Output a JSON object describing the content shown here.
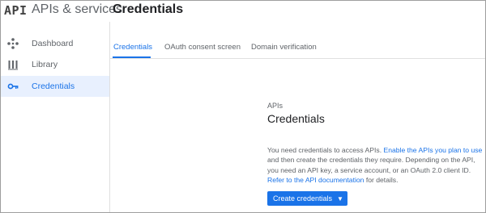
{
  "header": {
    "logo_text": "API",
    "product_name": "APIs & services",
    "page_title": "Credentials"
  },
  "sidebar": {
    "items": [
      {
        "label": "Dashboard",
        "icon": "dashboard-icon",
        "active": false
      },
      {
        "label": "Library",
        "icon": "library-icon",
        "active": false
      },
      {
        "label": "Credentials",
        "icon": "key-icon",
        "active": true
      }
    ]
  },
  "tabs": [
    {
      "label": "Credentials",
      "active": true
    },
    {
      "label": "OAuth consent screen",
      "active": false
    },
    {
      "label": "Domain verification",
      "active": false
    }
  ],
  "main": {
    "eyebrow": "APIs",
    "title": "Credentials",
    "description": {
      "text_1": "You need credentials to access APIs. ",
      "link_1": "Enable the APIs you plan to use",
      "text_2": " and then create the credentials they require. Depending on the API, you need an API key, a service account, or an OAuth 2.0 client ID. ",
      "link_2": "Refer to the API documentation",
      "text_3": " for details."
    },
    "create_button": {
      "label": "Create credentials",
      "icon": "caret-down-icon"
    }
  },
  "colors": {
    "accent": "#1a73e8",
    "active_nav_bg": "#e8f0fe",
    "muted_text": "#5f6368"
  }
}
